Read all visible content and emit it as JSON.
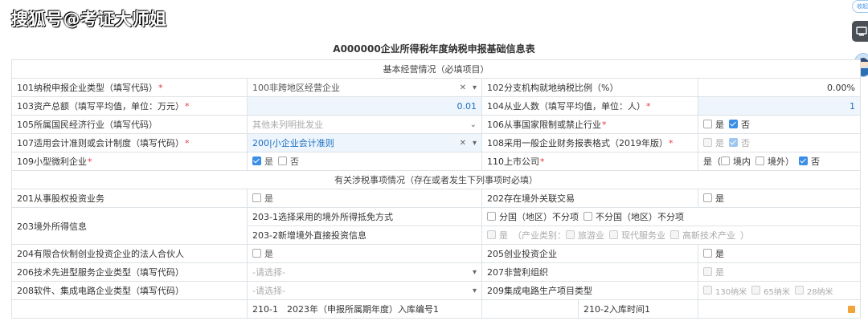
{
  "watermark": "搜狐号@考证大师姐",
  "side_tag": "收起",
  "title": "A000000企业所得税年度纳税申报基础信息表",
  "section1": "基本经营情况（必填项目）",
  "section2": "有关涉税事项情况（存在或者发生下列事项时必填）",
  "r101": {
    "label": "101纳税申报企业类型（填写代码）",
    "value": "100非跨地区经营企业",
    "label2": "102分支机构就地纳税比例（%）",
    "value2": "0.00%"
  },
  "r103": {
    "label": "103资产总额（填写平均值，单位：万元）",
    "value": "0.01",
    "label2": "104从业人数（填写平均值，单位：人）",
    "value2": "1"
  },
  "r105": {
    "label": "105所属国民经济行业（填写代码）",
    "value": "其他未列明批发业",
    "label2": "106从事国家限制或禁止行业",
    "yes": "是",
    "no": "否"
  },
  "r107": {
    "label": "107适用会计准则或会计制度（填写代码）",
    "value": "200|小企业会计准则",
    "label2": "108采用一般企业财务报表格式（2019年版）",
    "yes": "是",
    "no": "否"
  },
  "r109": {
    "label": "109小型微利企业",
    "yes": "是",
    "no": "否",
    "label2": "110上市公司",
    "prefix": "是（",
    "domestic": "境内",
    "foreign": "境外）",
    "no2": "否"
  },
  "r201": {
    "label": "201从事股权投资业务",
    "yes": "是",
    "label2": "202存在境外关联交易",
    "yes2": "是"
  },
  "r203": {
    "label": "203境外所得信息",
    "sub1": "203-1选择采用的境外所得抵免方式",
    "opt1": "分国（地区）不分项",
    "opt2": "不分国（地区）不分项",
    "sub2": "203-2新增境外直接投资信息",
    "yes": "是",
    "industry": "（产业类别：",
    "tour": "旅游业",
    "service": "现代服务业",
    "hitech": "高新技术产业",
    "close": "）"
  },
  "r204": {
    "label": "204有限合伙制创业投资企业的法人合伙人",
    "yes": "是",
    "label2": "205创业投资企业",
    "yes2": "是"
  },
  "r206": {
    "label": "206技术先进型服务企业类型（填写代码）",
    "value": "-请选择-",
    "label2": "207非营利组织",
    "yes2": "是"
  },
  "r208": {
    "label": "208软件、集成电路企业类型（填写代码）",
    "value": "-请选择-",
    "label2": "209集成电路生产项目类型",
    "o130": "130纳米",
    "o65": "65纳米",
    "o28": "28纳米"
  },
  "r210": {
    "sub1": "210-1　2023年（申报所属期年度）入库编号1",
    "sub2": "210-2入库时间1"
  }
}
